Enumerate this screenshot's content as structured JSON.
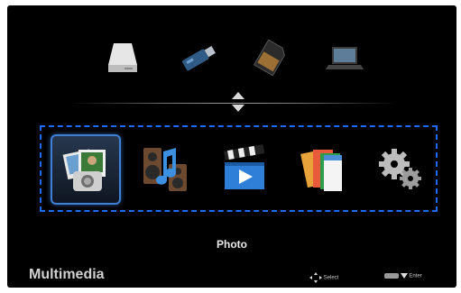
{
  "sources": [
    {
      "name": "hard-drive",
      "icon": "hard-drive-icon"
    },
    {
      "name": "usb",
      "icon": "usb-drive-icon"
    },
    {
      "name": "sd-card",
      "icon": "sd-card-icon"
    },
    {
      "name": "network-pc",
      "icon": "laptop-icon"
    }
  ],
  "carousel": {
    "items": [
      {
        "id": "photo",
        "icon": "photo-icon"
      },
      {
        "id": "music",
        "icon": "music-icon"
      },
      {
        "id": "video",
        "icon": "video-icon"
      },
      {
        "id": "office",
        "icon": "office-documents-icon"
      },
      {
        "id": "settings",
        "icon": "gears-icon"
      }
    ],
    "selected_label": "Photo"
  },
  "footer": {
    "title": "Multimedia",
    "select_hint": "Select",
    "enter_hint": "Enter"
  },
  "colors": {
    "background": "#000000",
    "focus": "#1e6bff",
    "selection": "#3f7fd8"
  }
}
